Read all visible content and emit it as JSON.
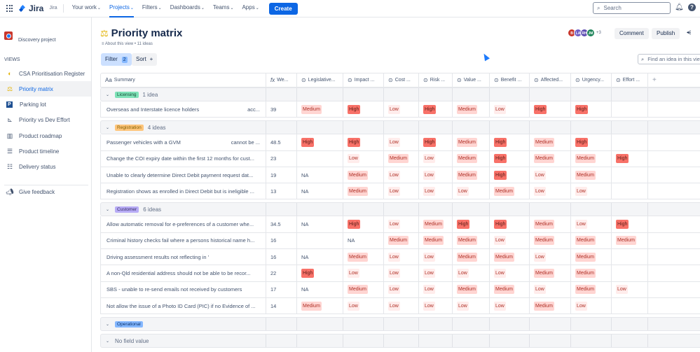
{
  "topbar": {
    "product": "Jira",
    "site": "Jira",
    "nav": [
      {
        "label": "Your work",
        "active": false
      },
      {
        "label": "Projects",
        "active": true
      },
      {
        "label": "Filters",
        "active": false
      },
      {
        "label": "Dashboards",
        "active": false
      },
      {
        "label": "Teams",
        "active": false
      },
      {
        "label": "Apps",
        "active": false
      }
    ],
    "create_label": "Create",
    "search_placeholder": "Search"
  },
  "sidebar": {
    "project_name": "Discovery project",
    "views_label": "VIEWS",
    "items": [
      {
        "label": "CSA Prioritisation Register",
        "icon": "list-view-icon",
        "glyph": "◐",
        "active": false
      },
      {
        "label": "Priority matrix",
        "icon": "scales-icon",
        "glyph": "⚖",
        "active": true
      },
      {
        "label": "Parking lot",
        "icon": "parking-icon",
        "glyph": "P",
        "active": false
      },
      {
        "label": "Priority vs Dev Effort",
        "icon": "matrix-icon",
        "glyph": "⊾",
        "active": false
      },
      {
        "label": "Product roadmap",
        "icon": "board-icon",
        "glyph": "▥",
        "active": false
      },
      {
        "label": "Product timeline",
        "icon": "timeline-icon",
        "glyph": "☰",
        "active": false
      },
      {
        "label": "Delivery status",
        "icon": "list-icon",
        "glyph": "☷",
        "active": false
      }
    ],
    "feedback_label": "Give feedback"
  },
  "header": {
    "title": "Priority matrix",
    "about": "About this view • 11 ideas",
    "filter_label": "Filter",
    "filter_count": "2",
    "sort_label": "Sort",
    "avatars": [
      {
        "initials": "B",
        "color": "#c9372c"
      },
      {
        "initials": "LA",
        "color": "#6e5dc6"
      },
      {
        "initials": "RH",
        "color": "#5e4db2"
      },
      {
        "initials": "JM",
        "color": "#1f845a"
      }
    ],
    "avatars_more": "+3",
    "comment_label": "Comment",
    "publish_label": "Publish",
    "find_placeholder": "Find an idea in this view"
  },
  "columns": [
    {
      "label": "Summary",
      "icon": "Aa"
    },
    {
      "label": "We...",
      "icon": "fx"
    },
    {
      "label": "Legislative...",
      "icon": "⊙"
    },
    {
      "label": "Impact ...",
      "icon": "⊙"
    },
    {
      "label": "Cost ...",
      "icon": "⊙"
    },
    {
      "label": "Risk ...",
      "icon": "⊙"
    },
    {
      "label": "Value ...",
      "icon": "⊙"
    },
    {
      "label": "Benefit ...",
      "icon": "⊙"
    },
    {
      "label": "Affected...",
      "icon": "⊙"
    },
    {
      "label": "Urgency...",
      "icon": "⊙"
    },
    {
      "label": "Effort ...",
      "icon": "⊙"
    }
  ],
  "groups": [
    {
      "name": "Licensing",
      "count": "1 idea",
      "tag_bg": "#7ee2b8",
      "tag_fg": "#164b35",
      "rows": [
        {
          "summary": "Overseas and Interstate licence holders",
          "summary_tail": "acc...",
          "weight": "39",
          "values": [
            "Medium",
            "High",
            "Low",
            "High",
            "Medium",
            "Low",
            "High",
            "High",
            ""
          ]
        }
      ]
    },
    {
      "name": "Registration",
      "count": "4 ideas",
      "tag_bg": "#fec57b",
      "tag_fg": "#7f5f01",
      "rows": [
        {
          "summary": "Passenger vehicles with a GVM",
          "summary_tail": "cannot be ...",
          "weight": "48.5",
          "values": [
            "High",
            "High",
            "Low",
            "High",
            "Medium",
            "High",
            "Medium",
            "High",
            ""
          ]
        },
        {
          "summary": "Change the COI expiry date within the first 12 months for cust...",
          "summary_tail": "",
          "weight": "23",
          "values": [
            "",
            "Low",
            "Medium",
            "Low",
            "Medium",
            "High",
            "Medium",
            "Medium",
            "High"
          ]
        },
        {
          "summary": "Unable to clearly determine Direct Debit payment request dat...",
          "summary_tail": "",
          "weight": "19",
          "values": [
            "NA",
            "Medium",
            "Low",
            "Low",
            "Medium",
            "High",
            "Low",
            "Medium",
            ""
          ]
        },
        {
          "summary": "Registration shows as enrolled in Direct Debit but is ineligible ...",
          "summary_tail": "",
          "weight": "13",
          "values": [
            "NA",
            "Medium",
            "Low",
            "Low",
            "Low",
            "Medium",
            "Low",
            "Low",
            ""
          ]
        }
      ]
    },
    {
      "name": "Customer",
      "count": "6 ideas",
      "tag_bg": "#b8acf6",
      "tag_fg": "#352c63",
      "rows": [
        {
          "summary": "Allow automatic removal for e-preferences of a customer whe...",
          "summary_tail": "",
          "weight": "34.5",
          "values": [
            "NA",
            "High",
            "Low",
            "Medium",
            "High",
            "High",
            "Medium",
            "Low",
            "High"
          ]
        },
        {
          "summary": "Criminal history checks fail where a persons historical name h...",
          "summary_tail": "",
          "weight": "16",
          "values": [
            "",
            "NA",
            "Medium",
            "Medium",
            "Medium",
            "Low",
            "Medium",
            "Medium",
            "Medium"
          ]
        },
        {
          "summary": "Driving assessment results not reflecting in '",
          "summary_tail": "",
          "weight": "16",
          "values": [
            "NA",
            "Medium",
            "Low",
            "Low",
            "Medium",
            "Medium",
            "Low",
            "Medium",
            ""
          ]
        },
        {
          "summary": "A non-Qld residential address should not be able to be recor...",
          "summary_tail": "",
          "weight": "22",
          "values": [
            "High",
            "Low",
            "Low",
            "Low",
            "Low",
            "Low",
            "Medium",
            "Medium",
            ""
          ]
        },
        {
          "summary": "SBS - unable to re-send emails not received by customers",
          "summary_tail": "",
          "weight": "17",
          "values": [
            "NA",
            "Medium",
            "Low",
            "Low",
            "Medium",
            "Medium",
            "Low",
            "Medium",
            "Low"
          ]
        },
        {
          "summary": "Not allow the issue of a Photo ID Card (PIC) if no Evidence of ...",
          "summary_tail": "",
          "weight": "14",
          "values": [
            "Medium",
            "Low",
            "Low",
            "Low",
            "Low",
            "Low",
            "Medium",
            "Low",
            ""
          ]
        }
      ]
    },
    {
      "name": "Operational",
      "count": "",
      "tag_bg": "#85b8ff",
      "tag_fg": "#09326c",
      "rows": []
    },
    {
      "name": "No field value",
      "count": "",
      "tag_bg": "",
      "tag_fg": "#626f86",
      "rows": []
    }
  ]
}
